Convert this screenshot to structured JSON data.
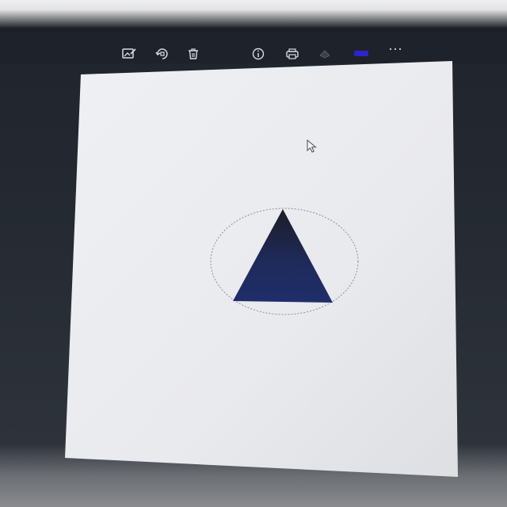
{
  "toolbar": {
    "tools": [
      {
        "name": "edit-image-icon",
        "label": ""
      },
      {
        "name": "rotate-icon",
        "label": ""
      },
      {
        "name": "delete-icon",
        "label": ""
      },
      {
        "name": "info-icon",
        "label": ""
      },
      {
        "name": "print-icon",
        "label": ""
      },
      {
        "name": "fill-color-icon",
        "label": ""
      },
      {
        "name": "stroke-color-icon",
        "label": ""
      },
      {
        "name": "more-options-icon",
        "label": "···"
      }
    ],
    "accent_color": "#2d24c9"
  },
  "canvas": {
    "shapes": [
      {
        "type": "triangle",
        "fill": "#1c2a5a",
        "selected": true
      },
      {
        "type": "selection-ellipse",
        "stroke": "#888888"
      }
    ]
  }
}
